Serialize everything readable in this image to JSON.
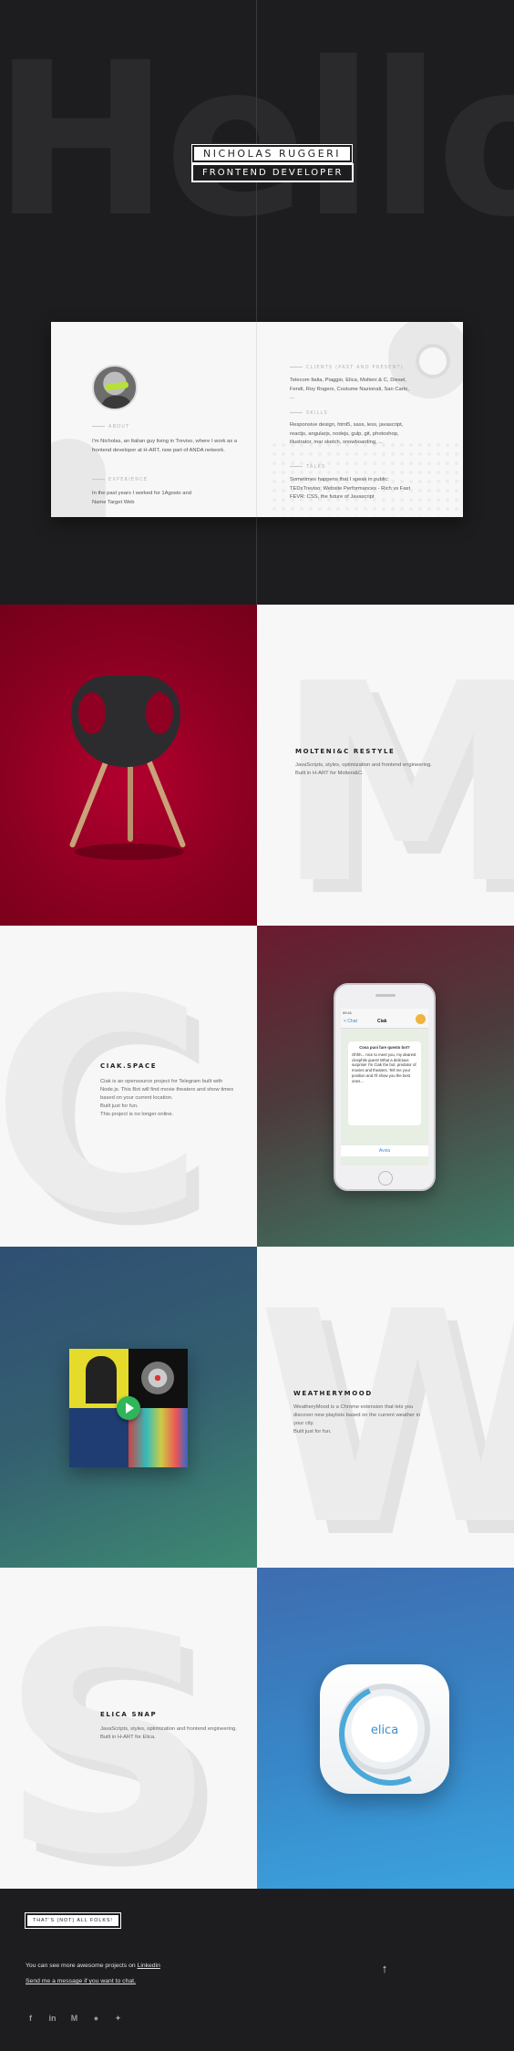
{
  "hero": {
    "big_word": "Hello",
    "name": "NICHOLAS RUGGERI",
    "role": "FRONTEND DEVELOPER"
  },
  "about": {
    "about_label": "ABOUT",
    "about_text": "I'm Nicholas, an Italian guy living in Treviso, where I work as a frontend developer at H-ART, now part of ANDA network.",
    "experience_label": "EXPERIENCE",
    "experience_text": "In the past years I worked for 1Agosto and Name Target Web",
    "clients_label": "CLIENTS (PAST AND PRESENT)",
    "clients_text": "Telecom Italia, Piaggio, Elica, Molteni & C, Diesel, Fendi, Roy Rogers, Costume Nazionali, San Carlo, ...",
    "skills_label": "SKILLS",
    "skills_text": "Responsive design, html5, sass, less, javascript, reactjs, angularjs, nodejs, gulp, git, photoshop, illustrator, mar sketch, snowboarding, ...",
    "talks_label": "TALKS",
    "talks_text": "Sometimes happens that I speak in public: TEDxTreviso: Website Performances - Rich vs Fast FEVR: CSS, the future of Javascript"
  },
  "projects": [
    {
      "title": "MOLTENI&C RESTYLE",
      "desc": "JavaScripts, styles, optimization and frontend engineering.\nBuilt in H-ART for Molteni&C.",
      "letter": "M"
    },
    {
      "title": "CIAK.SPACE",
      "desc": "Ciak is an opensource project for Telegram built with Node.js. This Bot will find movie theaters and show times based on your current location.\nBuilt just for fun.\nThis project is no longer online.",
      "letter": "C"
    },
    {
      "title": "WEATHERYMOOD",
      "desc": "WeatheryMood is a Chrome extension that lets you discover new playlists based on the current weather in your city.\nBuilt just for fun.",
      "letter": "W"
    },
    {
      "title": "ELICA SNAP",
      "desc": "JavaScripts, styles, optimization and frontend engineering.\nBuilt in H-ART for Elica.",
      "letter": "S"
    }
  ],
  "phone": {
    "back": "< Chat",
    "chat_name": "Ciak",
    "time": "09:41",
    "bubble_title": "Cosa puoi fare questo bot?",
    "bubble_text": "Ohhh... nice to meet you, my dearest cinephile guest! What a delicious surprise! I'm Ciak the bot, predator of movies and theaters. Tell me your position and I'll show you the best ones...",
    "button": "Avvia"
  },
  "app_icon": {
    "logo": "elica"
  },
  "footer": {
    "badge": "THAT'S (NOT) ALL FOLKS!",
    "more_prefix": "You can see more awesome projects on ",
    "more_link": "Linkedin",
    "message_link": "Send me a message if you want to chat.",
    "back_to_top": "↑",
    "socials": [
      "facebook-icon",
      "linkedin-icon",
      "medium-icon",
      "github-icon",
      "twitter-icon"
    ]
  },
  "colors": {
    "dark": "#1d1d1f",
    "molteni_red": "#8c0021",
    "ciak_gradient_end": "#3e7a66",
    "weathery_blue": "#2f4f73",
    "elica_blue": "#3887c8"
  }
}
